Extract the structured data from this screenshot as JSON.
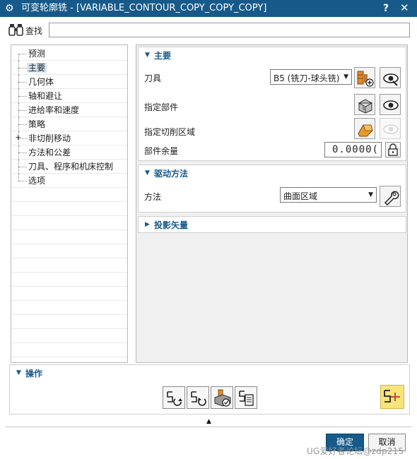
{
  "window": {
    "title": "可变轮廓铣 - [VARIABLE_CONTOUR_COPY_COPY_COPY]",
    "help": "?",
    "close": "✕"
  },
  "find": {
    "label": "查找",
    "value": ""
  },
  "tree": {
    "items": [
      {
        "label": "预测",
        "selected": false,
        "expandable": false
      },
      {
        "label": "主要",
        "selected": true,
        "expandable": false
      },
      {
        "label": "几何体",
        "selected": false,
        "expandable": false
      },
      {
        "label": "轴和避让",
        "selected": false,
        "expandable": false
      },
      {
        "label": "进给率和速度",
        "selected": false,
        "expandable": false
      },
      {
        "label": "策略",
        "selected": false,
        "expandable": false
      },
      {
        "label": "非切削移动",
        "selected": false,
        "expandable": true
      },
      {
        "label": "方法和公差",
        "selected": false,
        "expandable": false
      },
      {
        "label": "刀具、程序和机床控制",
        "selected": false,
        "expandable": false
      },
      {
        "label": "选项",
        "selected": false,
        "expandable": false
      }
    ]
  },
  "main_group": {
    "title": "主要",
    "tool_label": "刀具",
    "tool_value": "B5 (铣刀-球头铣)",
    "part_label": "指定部件",
    "cut_area_label": "指定切削区域",
    "stock_label": "部件余量",
    "stock_value": "0.0000("
  },
  "drive_group": {
    "title": "驱动方法",
    "method_label": "方法",
    "method_value": "曲面区域"
  },
  "projection_group": {
    "title": "投影矢量"
  },
  "actions": {
    "title": "操作"
  },
  "buttons": {
    "ok": "确定",
    "cancel": "取消"
  },
  "watermark": "UG爱好者论坛@zdp215",
  "colors": {
    "accent": "#175a8a",
    "selection": "#d4e6f4",
    "generate_highlight": "#f7e47a"
  }
}
